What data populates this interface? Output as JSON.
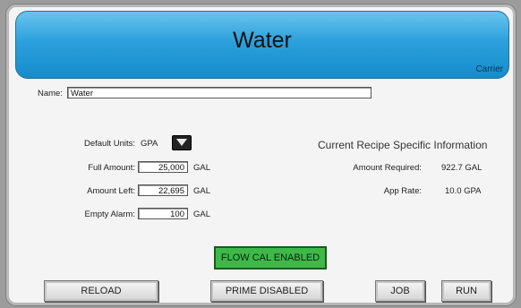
{
  "header": {
    "title": "Water",
    "subtitle": "Carrier"
  },
  "name_field": {
    "label": "Name:",
    "value": "Water"
  },
  "units": {
    "label": "Default Units:",
    "value": "GPA"
  },
  "full_amount": {
    "label": "Full Amount:",
    "value": "25,000",
    "unit": "GAL"
  },
  "amount_left": {
    "label": "Amount Left:",
    "value": "22,695",
    "unit": "GAL"
  },
  "empty_alarm": {
    "label": "Empty Alarm:",
    "value": "100",
    "unit": "GAL"
  },
  "recipe": {
    "title": "Current Recipe Specific Information",
    "amount_required_label": "Amount Required:",
    "amount_required_value": "922.7 GAL",
    "app_rate_label": "App Rate:",
    "app_rate_value": "10.0 GPA"
  },
  "buttons": {
    "flow_cal": "FLOW CAL ENABLED",
    "reload": "RELOAD",
    "prime": "PRIME DISABLED",
    "job": "JOB",
    "run": "RUN"
  },
  "colors": {
    "header_blue": "#2ba0dc",
    "flow_cal_green": "#3fb84a",
    "panel_bg": "#f4f4f4"
  }
}
